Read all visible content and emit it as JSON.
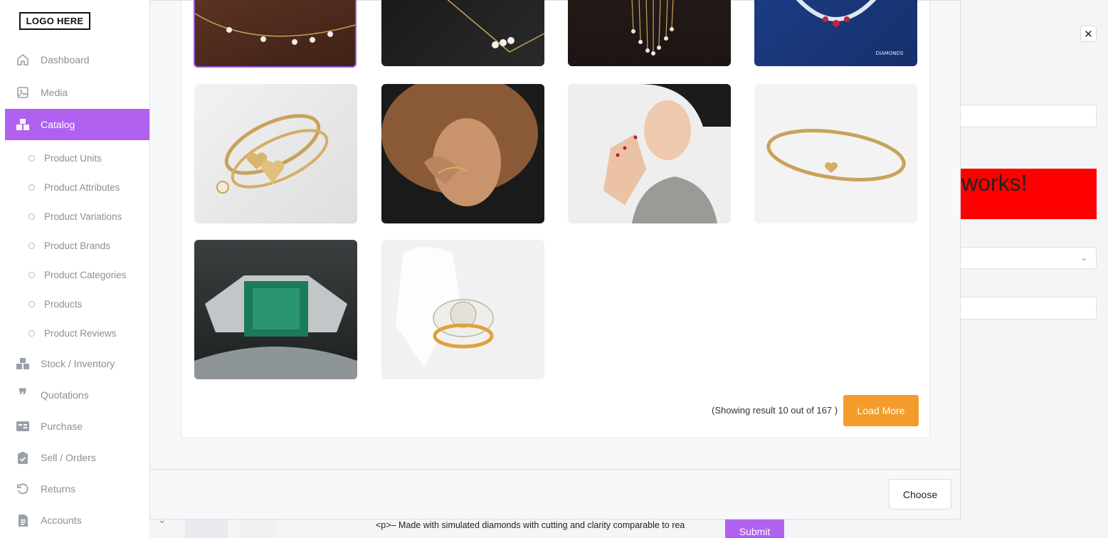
{
  "brand": {
    "logo_text": "LOGO HERE"
  },
  "sidebar": {
    "items": [
      {
        "label": "Dashboard",
        "icon": "home-icon"
      },
      {
        "label": "Media",
        "icon": "image-icon"
      },
      {
        "label": "Catalog",
        "icon": "boxes-icon",
        "active": true
      },
      {
        "label": "Stock / Inventory",
        "icon": "boxes-icon"
      },
      {
        "label": "Quotations",
        "icon": "quote-icon"
      },
      {
        "label": "Purchase",
        "icon": "card-icon"
      },
      {
        "label": "Sell / Orders",
        "icon": "clipboard-check-icon"
      },
      {
        "label": "Returns",
        "icon": "undo-icon"
      },
      {
        "label": "Accounts",
        "icon": "file-invoice-icon"
      }
    ],
    "catalog_sub": [
      "Product Units",
      "Product Attributes",
      "Product Variations",
      "Product Brands",
      "Product Categories",
      "Products",
      "Product Reviews"
    ]
  },
  "background_form": {
    "banner_text": "works!",
    "description_preview": "<p>– Made with simulated diamonds with cutting and clarity comparable to rea",
    "submit_label": "Submit",
    "close_symbol": "✕"
  },
  "media_modal": {
    "images": [
      {
        "alt": "pearl station necklace",
        "selected": true
      },
      {
        "alt": "triple pearl necklace"
      },
      {
        "alt": "pearl fringe necklace"
      },
      {
        "alt": "ruby diamond necklace on blue"
      },
      {
        "alt": "gold charm bracelets"
      },
      {
        "alt": "woman wearing gold bracelet"
      },
      {
        "alt": "woman with rings and bracelet"
      },
      {
        "alt": "gold chain bracelet"
      },
      {
        "alt": "green tourmaline ring"
      },
      {
        "alt": "diamond cluster ring"
      }
    ],
    "showing_text": "(Showing result 10 out of 167 )",
    "load_more_label": "Load More",
    "choose_label": "Choose"
  },
  "colors": {
    "accent": "#b061f0",
    "load_more": "#f39c2c",
    "banner": "#ff0000"
  }
}
